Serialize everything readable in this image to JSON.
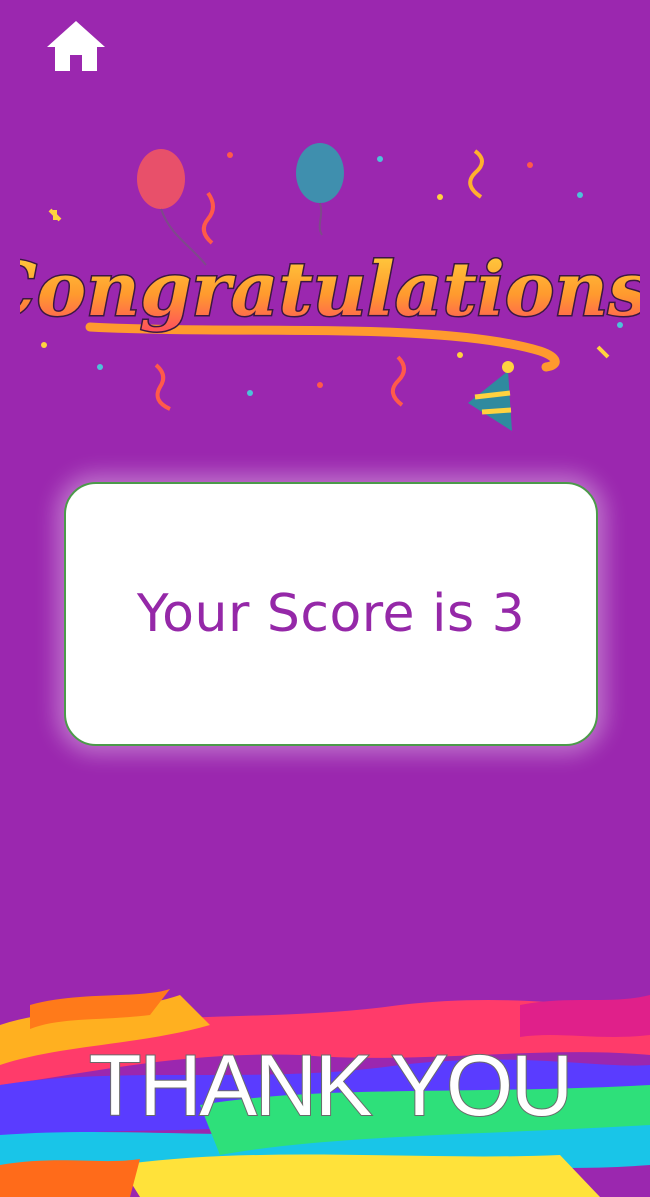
{
  "header": {
    "home_icon": "home-icon"
  },
  "banner": {
    "congrats_text": "Congratulations!"
  },
  "score_card": {
    "text": "Your Score is 3"
  },
  "footer": {
    "thank_you_text": "THANK YOU"
  },
  "colors": {
    "background": "#9b27af",
    "score_text": "#9528a8",
    "card_border": "#4c9a4a"
  }
}
